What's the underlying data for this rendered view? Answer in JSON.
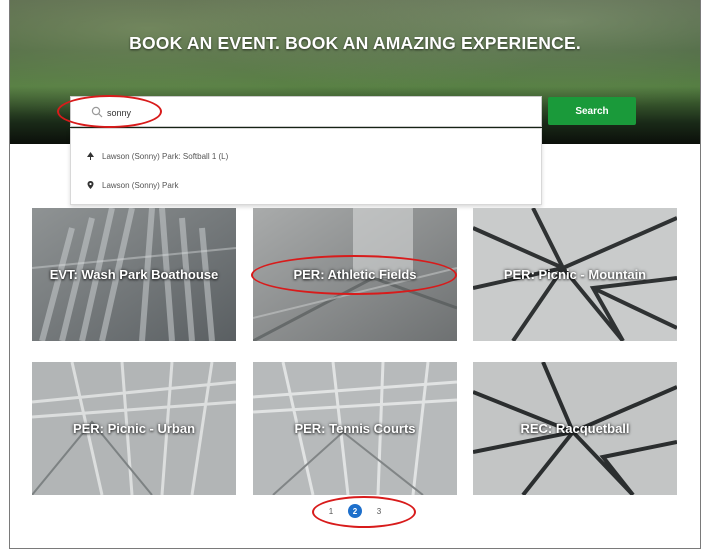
{
  "hero": {
    "title": "BOOK AN EVENT. BOOK AN AMAZING EXPERIENCE."
  },
  "search": {
    "value": "sonny",
    "placeholder": "",
    "button_label": "Search"
  },
  "suggestions": [
    {
      "icon": "tree-icon",
      "text": "Lawson (Sonny) Park: Softball 1 (L)"
    },
    {
      "icon": "map-pin-icon",
      "text": "Lawson (Sonny) Park"
    }
  ],
  "tiles": [
    {
      "label": "EVT: Wash Park Boathouse"
    },
    {
      "label": "PER: Athletic Fields"
    },
    {
      "label": "PER: Picnic - Mountain"
    },
    {
      "label": "PER: Picnic - Urban"
    },
    {
      "label": "PER: Tennis Courts"
    },
    {
      "label": "REC: Racquetball"
    }
  ],
  "pagination": {
    "pages": [
      "1",
      "2",
      "3"
    ],
    "current": "2"
  },
  "colors": {
    "search_button": "#1a9a3a",
    "active_page": "#1d6fcb",
    "annotation": "#d81b1b"
  }
}
